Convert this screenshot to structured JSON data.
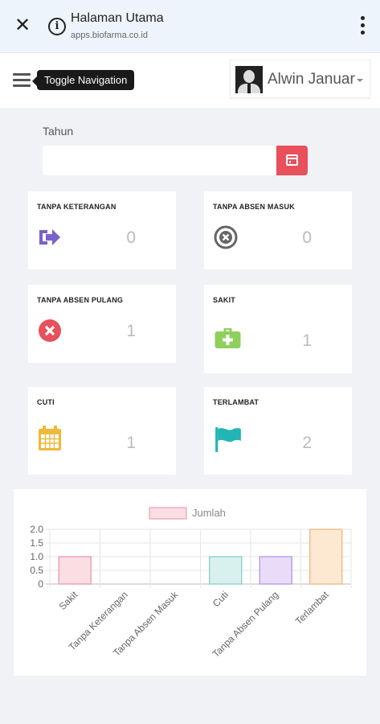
{
  "browser": {
    "title": "Halaman Utama",
    "url": "apps.biofarma.co.id",
    "close_glyph": "✕",
    "info_glyph": "i"
  },
  "header": {
    "tooltip": "Toggle Navigation",
    "user_name": "Alwin Januar"
  },
  "filter": {
    "label": "Tahun",
    "value": "",
    "accent": "#e8505b"
  },
  "cards": [
    {
      "label": "TANPA KETERANGAN",
      "value": "0",
      "icon": "sign-out-icon",
      "color": "#7b61c9"
    },
    {
      "label": "TANPA ABSEN MASUK",
      "value": "0",
      "icon": "times-circle-icon",
      "color": "#666666"
    },
    {
      "label": "TANPA ABSEN PULANG",
      "value": "1",
      "icon": "times-circle-icon",
      "color": "#e8505b"
    },
    {
      "label": "SAKIT",
      "value": "1",
      "icon": "medkit-icon",
      "color": "#8ed05a"
    },
    {
      "label": "CUTI",
      "value": "1",
      "icon": "calendar-icon",
      "color": "#efb93a"
    },
    {
      "label": "TERLAMBAT",
      "value": "2",
      "icon": "flag-icon",
      "color": "#23b5b5"
    }
  ],
  "chart_data": {
    "type": "bar",
    "legend": "Jumlah",
    "categories": [
      "Sakit",
      "Tanpa Keterangan",
      "Tanpa Absen Masuk",
      "Cuti",
      "Tanpa Absen Pulang",
      "Terlambat"
    ],
    "series": [
      {
        "name": "Jumlah",
        "values": [
          1,
          0,
          0,
          1,
          1,
          2
        ]
      }
    ],
    "ylim": [
      0,
      2
    ],
    "yticks": [
      "0",
      "0.5",
      "1.0",
      "1.5",
      "2.0"
    ],
    "grid": true,
    "legend_position": "top",
    "fill_colors": [
      "#fbdde4",
      "#fce5d2",
      "#fdf0d2",
      "#d9f1ee",
      "#e8dcf9",
      "#fde8d2"
    ],
    "stroke_colors": [
      "#e8a0b1",
      "#f2b98a",
      "#f2cf7d",
      "#8fd1c8",
      "#b59ce6",
      "#f2b98a"
    ]
  }
}
